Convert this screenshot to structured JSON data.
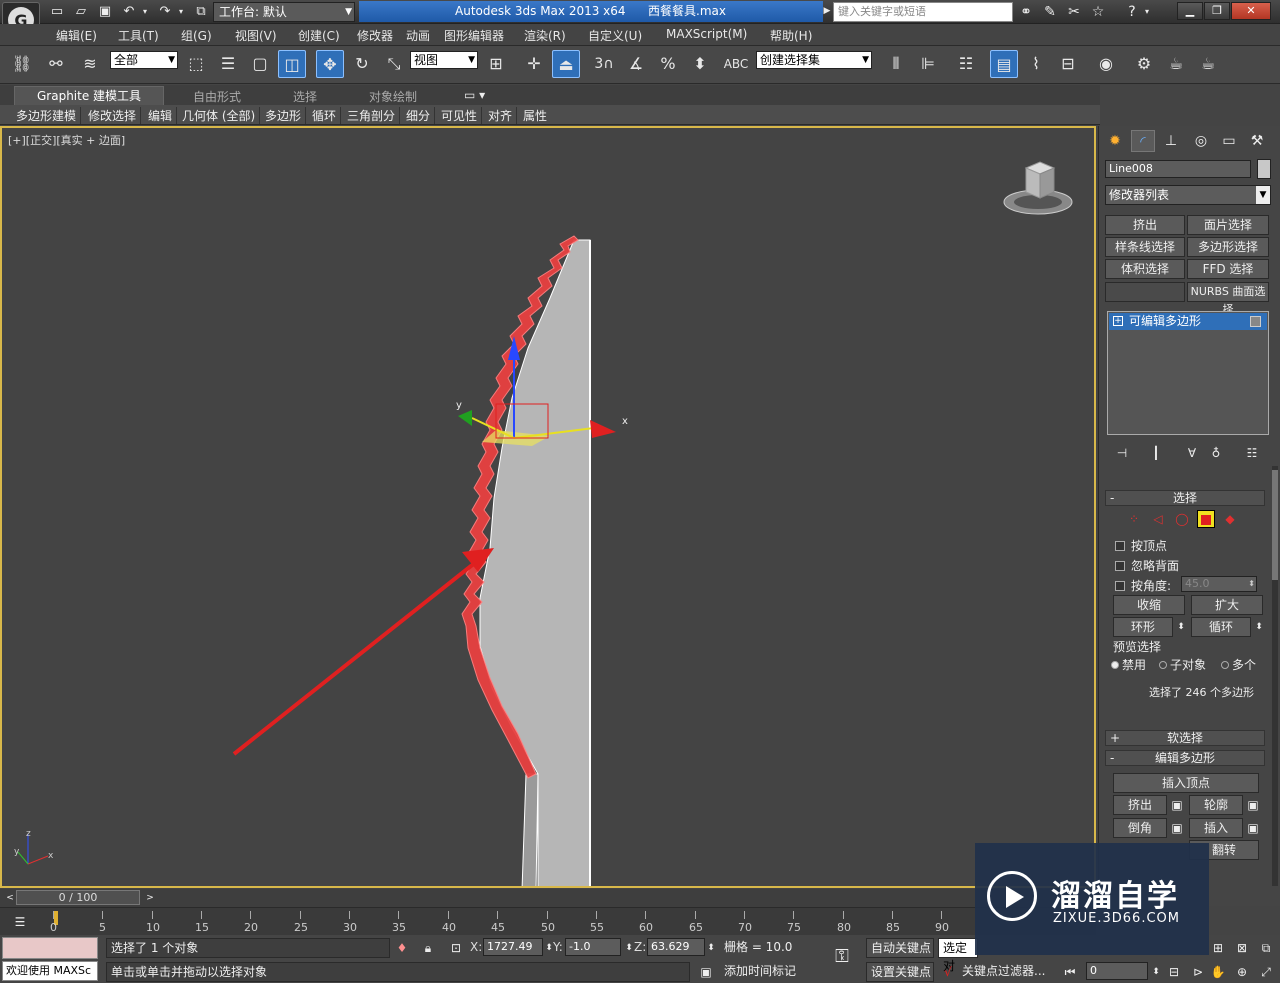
{
  "titlebar": {
    "workspace_label": "工作台: 默认",
    "app_title": "Autodesk 3ds Max  2013 x64",
    "file_name": "西餐餐具.max",
    "search_placeholder": "键入关键字或短语"
  },
  "menu": [
    "编辑(E)",
    "工具(T)",
    "组(G)",
    "视图(V)",
    "创建(C)",
    "修改器",
    "动画",
    "图形编辑器",
    "渲染(R)",
    "自定义(U)",
    "MAXScript(M)",
    "帮助(H)"
  ],
  "toolbar": {
    "filter_value": "全部",
    "ref_coord_value": "视图",
    "snap_angle_label": "3",
    "named_selection_value": "创建选择集"
  },
  "ribbon": {
    "tabs": [
      "Graphite 建模工具",
      "自由形式",
      "选择",
      "对象绘制"
    ],
    "panels": [
      "多边形建模",
      "修改选择",
      "编辑",
      "几何体 (全部)",
      "多边形",
      "循环",
      "三角剖分",
      "细分",
      "可见性",
      "对齐",
      "属性"
    ]
  },
  "viewport": {
    "label_prefix": "[+][",
    "label_view": "正交",
    "label_suffix": "][真实 + 边面]",
    "gizmo_x": "x",
    "gizmo_y": "y",
    "axis_x": "x",
    "axis_y": "y",
    "axis_z": "z"
  },
  "cmdpanel": {
    "object_name": "Line008",
    "modifier_list": "修改器列表",
    "buttons": [
      "挤出",
      "面片选择",
      "样条线选择",
      "多边形选择",
      "体积选择",
      "FFD 选择",
      "",
      "NURBS 曲面选择"
    ],
    "stack_item": "可编辑多边形",
    "selection": {
      "title": "选择",
      "by_vertex": "按顶点",
      "ignore_backfacing": "忽略背面",
      "by_angle": "按角度:",
      "angle_value": "45.0",
      "shrink": "收缩",
      "grow": "扩大",
      "ring": "环形",
      "loop": "循环",
      "preview_title": "预览选择",
      "preview_disabled": "禁用",
      "preview_subobject": "子对象",
      "preview_multi": "多个",
      "status": "选择了 246 个多边形"
    },
    "soft_selection_title": "软选择",
    "edit_poly": {
      "title": "编辑多边形",
      "insert_vertex": "插入顶点",
      "extrude": "挤出",
      "outline": "轮廓",
      "bevel": "倒角",
      "inset": "插入",
      "flip": "翻转"
    }
  },
  "timeline": {
    "frame_display": "0 / 100",
    "ticks": [
      "0",
      "5",
      "10",
      "15",
      "20",
      "25",
      "30",
      "35",
      "40",
      "45",
      "50",
      "55",
      "60",
      "65",
      "70",
      "75",
      "80",
      "85",
      "90"
    ]
  },
  "statusbar": {
    "maxscript_text": "欢迎使用 MAXSc",
    "selection_status": "选择了 1 个对象",
    "prompt": "单击或单击并拖动以选择对象",
    "x_label": "X:",
    "x_value": "1727.49",
    "y_label": "Y:",
    "y_value": "-1.0",
    "z_label": "Z:",
    "z_value": "63.629",
    "grid": "栅格 = 10.0",
    "add_time_tag": "添加时间标记",
    "auto_key": "自动关键点",
    "set_key": "设置关键点",
    "selected_value": "选定对",
    "key_filters": "关键点过滤器...",
    "frame_value": "0"
  },
  "watermark": {
    "name": "溜溜自学",
    "url": "ZIXUE.3D66.COM"
  },
  "colors": {
    "selection_red": "#e03a3a",
    "active_blue": "#2f6fb8",
    "viewport_border": "#d8b84a"
  }
}
